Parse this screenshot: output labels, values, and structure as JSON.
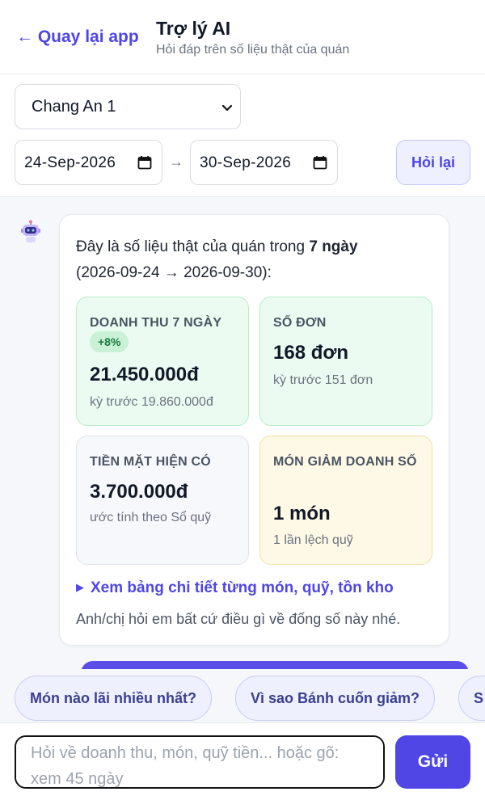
{
  "header": {
    "back_label": "← Quay lại app",
    "title": "Trợ lý AI",
    "subtitle": "Hỏi đáp trên số liệu thật của quán"
  },
  "filters": {
    "store_selected": "Chang An 1",
    "date_from": "24-Sep-2026",
    "date_separator": "→",
    "date_to": "30-Sep-2026",
    "ask_again_label": "Hỏi lại"
  },
  "message": {
    "intro_prefix": "Đây là số liệu thật của quán trong ",
    "intro_period": "7 ngày",
    "intro_range": "(2026-09-24 → 2026-09-30):",
    "cards": [
      {
        "label": "DOANH THU 7 NGÀY",
        "badge": "+8%",
        "value": "21.450.000đ",
        "sub": "kỳ trước 19.860.000đ",
        "tone": "green"
      },
      {
        "label": "SỐ ĐƠN",
        "value": "168 đơn",
        "sub": "kỳ trước 151 đơn",
        "tone": "green"
      },
      {
        "label": "TIỀN MẶT HIỆN CÓ",
        "value": "3.700.000đ",
        "sub": "ước tính theo Sổ quỹ",
        "tone": "gray"
      },
      {
        "label": "MÓN GIẢM DOANH SỐ",
        "value": "1 món",
        "sub": "1 lần lệch quỹ",
        "tone": "yellow"
      }
    ],
    "details_label": "Xem bảng chi tiết từng món, quỹ, tồn kho",
    "closing": "Anh/chị hỏi em bất cứ điều gì về đống số này nhé."
  },
  "suggestions": [
    "Món nào lãi nhiều nhất?",
    "Vì sao Bánh cuốn giảm?",
    "S"
  ],
  "composer": {
    "placeholder": "Hỏi về doanh thu, món, quỹ tiền... hoặc gõ: xem 45 ngày",
    "send_label": "Gửi"
  },
  "colors": {
    "accent": "#4f46e5",
    "green_card": "#ecfbf1",
    "yellow_card": "#fef9e6",
    "badge_green": "#c8f1d6"
  }
}
